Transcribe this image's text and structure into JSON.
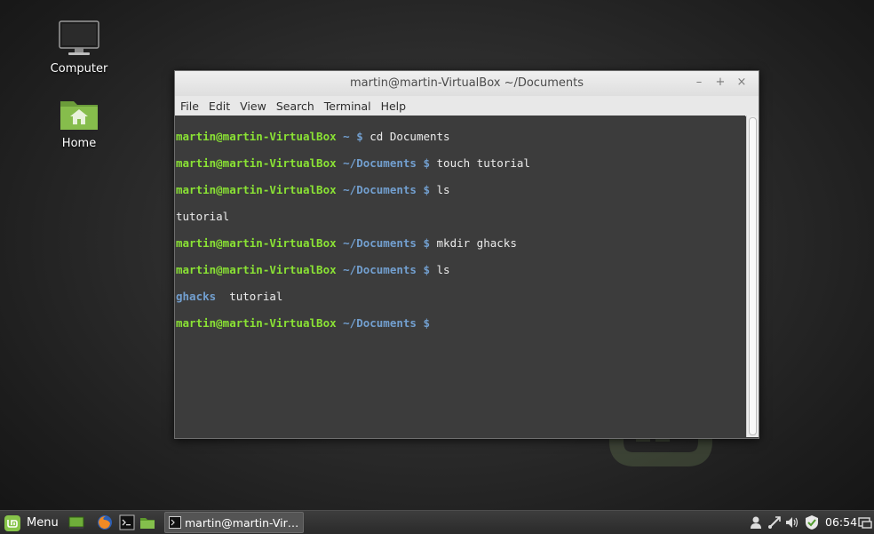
{
  "desktop": {
    "icons": [
      {
        "label": "Computer",
        "icon": "monitor-icon"
      },
      {
        "label": "Home",
        "icon": "folder-home-icon"
      }
    ]
  },
  "window": {
    "title": "martin@martin-VirtualBox ~/Documents",
    "controls": [
      "–",
      "+",
      "×"
    ],
    "menu": [
      "File",
      "Edit",
      "View",
      "Search",
      "Terminal",
      "Help"
    ]
  },
  "terminal": {
    "lines": [
      {
        "user": "martin@martin-VirtualBox",
        "path": " ~ ",
        "prompt": "$ ",
        "cmd": "cd Documents"
      },
      {
        "user": "martin@martin-VirtualBox",
        "path": " ~/Documents ",
        "prompt": "$ ",
        "cmd": "touch tutorial"
      },
      {
        "user": "martin@martin-VirtualBox",
        "path": " ~/Documents ",
        "prompt": "$ ",
        "cmd": "ls"
      },
      {
        "plain": "tutorial"
      },
      {
        "user": "martin@martin-VirtualBox",
        "path": " ~/Documents ",
        "prompt": "$ ",
        "cmd": "mkdir ghacks"
      },
      {
        "user": "martin@martin-VirtualBox",
        "path": " ~/Documents ",
        "prompt": "$ ",
        "cmd": "ls"
      },
      {
        "dir": "ghacks",
        "plain": "  tutorial"
      },
      {
        "user": "martin@martin-VirtualBox",
        "path": " ~/Documents ",
        "prompt": "$ ",
        "cmd": ""
      }
    ],
    "colors": {
      "user": "#8ae234",
      "path": "#729fcf",
      "bg": "#3c3c3c",
      "fg": "#ececec"
    }
  },
  "panel": {
    "menu_label": "Menu",
    "launchers": [
      "show-desktop-icon",
      "firefox-icon",
      "terminal-icon",
      "files-icon"
    ],
    "task": {
      "label": "martin@martin-VirtualBox ~/Documents",
      "icon": "terminal-icon"
    },
    "tray": [
      "user-icon",
      "network-icon",
      "volume-icon",
      "update-shield-icon",
      "window-list-icon"
    ],
    "clock": "06:54"
  }
}
